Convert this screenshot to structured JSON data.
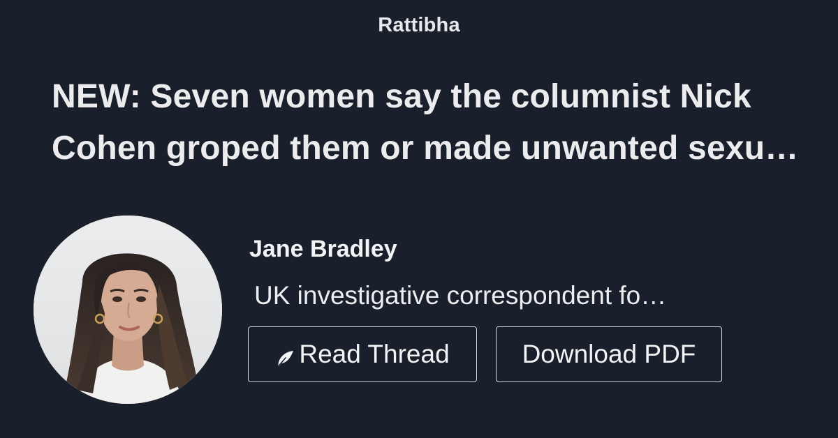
{
  "brand": "Rattibha",
  "thread": {
    "title": "NEW: Seven women say the columnist Nick Cohen groped them or made unwanted sexual advances"
  },
  "author": {
    "name": "Jane Bradley",
    "bio": "UK investigative correspondent for The New York Times"
  },
  "actions": {
    "read_thread": "Read Thread",
    "download_pdf": "Download PDF"
  },
  "icons": {
    "read_thread": "feather-icon"
  },
  "colors": {
    "background": "#19202b",
    "text": "#eceff3",
    "button_border": "#d8dbe0"
  }
}
